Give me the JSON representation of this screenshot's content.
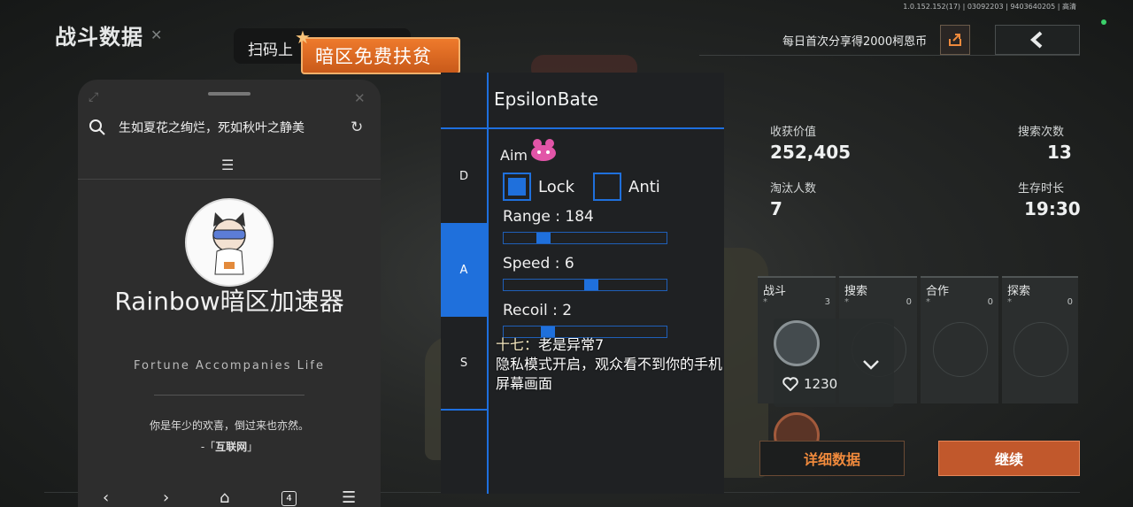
{
  "game": {
    "version": "1.0.152.152(17) | 03092203 | 9403640205 | 高清",
    "title": "战斗数据",
    "share_text": "每日首次分享得2000柯恩币",
    "stats": {
      "value_label": "收获价值",
      "value": "252,405",
      "search_label": "搜索次数",
      "search": "13",
      "eliminated_label": "淘汰人数",
      "eliminated": "7",
      "survival_label": "生存时长",
      "survival": "19:30"
    },
    "cards": [
      {
        "title": "战斗",
        "num": "3"
      },
      {
        "title": "搜索",
        "num": "0"
      },
      {
        "title": "合作",
        "num": "0"
      },
      {
        "title": "探索",
        "num": "0"
      }
    ],
    "likes": "1230",
    "detail_button": "详细数据",
    "continue_button": "继续"
  },
  "scan_toast": {
    "text": "扫码上",
    "promo": "暗区免费扶贫"
  },
  "phone": {
    "search_text": "生如夏花之绚烂，死如秋叶之静美",
    "app_name": "Rainbow暗区加速器",
    "app_sub": "Fortune Accompanies Life",
    "quote": "你是年少的欢喜，倒过来也亦然。",
    "quote_source_pre": "-「",
    "quote_source": "互联网",
    "quote_source_post": "」",
    "tab_count": "4"
  },
  "menu": {
    "title": "EpsilonBate",
    "tabs": [
      "D",
      "A",
      "S"
    ],
    "aim_label": "Aim",
    "lock_label": "Lock",
    "anti_label": "Anti",
    "sliders": [
      {
        "label": "Range : 184",
        "fraction": 0.22
      },
      {
        "label": "Speed : 6",
        "fraction": 0.55
      },
      {
        "label": "Recoil : 2",
        "fraction": 0.25
      }
    ]
  },
  "overlay": {
    "name": "十七：",
    "line1": "老是异常7",
    "line2": "隐私模式开启，观众看不到你的手机",
    "line3": "屏幕画面"
  },
  "colors": {
    "accent_blue": "#1f70dc",
    "accent_orange": "#c1582c"
  }
}
